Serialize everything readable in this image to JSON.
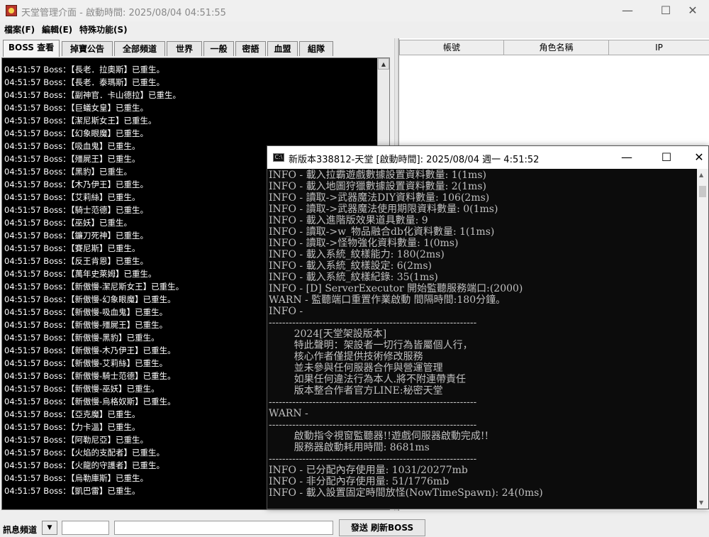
{
  "window": {
    "title": "天堂管理介面 - 啟動時間: 2025/08/04 04:51:55",
    "minimize": "—",
    "maximize": "☐",
    "close": "✕"
  },
  "menus": [
    {
      "label": "檔案(F)"
    },
    {
      "label": "編輯(E)"
    },
    {
      "label": "特殊功能(S)"
    }
  ],
  "tabs": [
    {
      "label": "BOSS 查看",
      "active": true
    },
    {
      "label": "掉寶公告"
    },
    {
      "label": "全部頻道"
    },
    {
      "label": "世界"
    },
    {
      "label": "一般"
    },
    {
      "label": "密語"
    },
    {
      "label": "血盟"
    },
    {
      "label": "組隊"
    }
  ],
  "boss_log": [
    "04:51:57 Boss：【長老．拉奧斯】已重生。",
    "04:51:57 Boss：【長老．泰瑪斯】已重生。",
    "04:51:57 Boss：【副神官．卡山德拉】已重生。",
    "04:51:57 Boss：【巨蟻女皇】已重生。",
    "04:51:57 Boss：【潔尼斯女王】已重生。",
    "04:51:57 Boss：【幻象眼魔】已重生。",
    "04:51:57 Boss：【吸血鬼】已重生。",
    "04:51:57 Boss：【殭屍王】已重生。",
    "04:51:57 Boss：【黑豹】已重生。",
    "04:51:57 Boss：【木乃伊王】已重生。",
    "04:51:57 Boss：【艾莉絲】已重生。",
    "04:51:57 Boss：【騎士范德】已重生。",
    "04:51:57 Boss：【巫妖】已重生。",
    "04:51:57 Boss：【鐮刀死神】已重生。",
    "04:51:57 Boss：【賽尼斯】已重生。",
    "04:51:57 Boss：【反王肯恩】已重生。",
    "04:51:57 Boss：【萬年史萊姆】已重生。",
    "04:51:57 Boss：【新傲慢-潔尼斯女王】已重生。",
    "04:51:57 Boss：【新傲慢-幻象眼魔】已重生。",
    "04:51:57 Boss：【新傲慢-吸血鬼】已重生。",
    "04:51:57 Boss：【新傲慢-殭屍王】已重生。",
    "04:51:57 Boss：【新傲慢-黑豹】已重生。",
    "04:51:57 Boss：【新傲慢-木乃伊王】已重生。",
    "04:51:57 Boss：【新傲慢-艾莉絲】已重生。",
    "04:51:57 Boss：【新傲慢-騎士范德】已重生。",
    "04:51:57 Boss：【新傲慢-巫妖】已重生。",
    "04:51:57 Boss：【新傲慢-烏格奴斯】已重生。",
    "04:51:57 Boss：【亞克魔】已重生。",
    "04:51:57 Boss：【力卡溫】已重生。",
    "04:51:57 Boss：【阿勒尼亞】已重生。",
    "04:51:57 Boss：【火焰的支配者】已重生。",
    "04:51:57 Boss：【火龍的守護者】已重生。",
    "04:51:57 Boss：【烏勒庫斯】已重生。",
    "04:51:57 Boss：【凱巴雷】已重生。"
  ],
  "table": {
    "columns": [
      "帳號",
      "角色名稱",
      "IP"
    ]
  },
  "bottom": {
    "channel_label": "訊息頻道",
    "send_label": "發送 刷新BOSS"
  },
  "console": {
    "title": "新版本338812-天堂 [啟動時間]: 2025/08/04 週一  4:51:52",
    "icon_text": "C:\\",
    "lines": [
      "INFO - 載入拉霸遊戲數據設置資料數量: 1(1ms)",
      "INFO - 載入地圖狩獵數據設置資料數量: 2(1ms)",
      "INFO - 讀取->武器魔法DIY資料數量: 106(2ms)",
      "INFO - 讀取->武器魔法使用期限資料數量: 0(1ms)",
      "INFO - 載入進階版效果道具數量: 9",
      "INFO - 讀取->w_物品融合db化資料數量: 1(1ms)",
      "INFO - 讀取->怪物強化資料數量: 1(0ms)",
      "INFO - 載入系統_紋樣能力: 180(2ms)",
      "INFO - 載入系統_紋樣設定: 6(2ms)",
      "INFO - 載入系統_紋樣紀錄: 35(1ms)",
      "INFO - [D] ServerExecutor 開始監聽服務端口:(2000)",
      "WARN - 監聽端口重置作業啟動 間隔時間:180分鐘。",
      "INFO -",
      "--------------------------------------------------------------",
      "        2024[天堂架設版本]",
      "        特此聲明：架設者一切行為皆屬個人行，",
      "        核心作者僅提供技術修改服務",
      "        並未參與任何服器合作與營運管理",
      "        如果任何違法行為本人.將不附連帶責任",
      "        版本整合作者官方LINE:秘密天堂",
      "--------------------------------------------------------------",
      "WARN -",
      "--------------------------------------------------------------",
      "        啟動指令視窗監聽器!!遊戲伺服器啟動完成!!",
      "        服務器啟動耗用時間: 8681ms",
      "--------------------------------------------------------------",
      "INFO - 已分配內存使用量: 1031/20277mb",
      "INFO - 非分配內存使用量: 51/1776mb",
      "INFO - 載入設置固定時間放怪(NowTimeSpawn): 24(0ms)"
    ]
  }
}
